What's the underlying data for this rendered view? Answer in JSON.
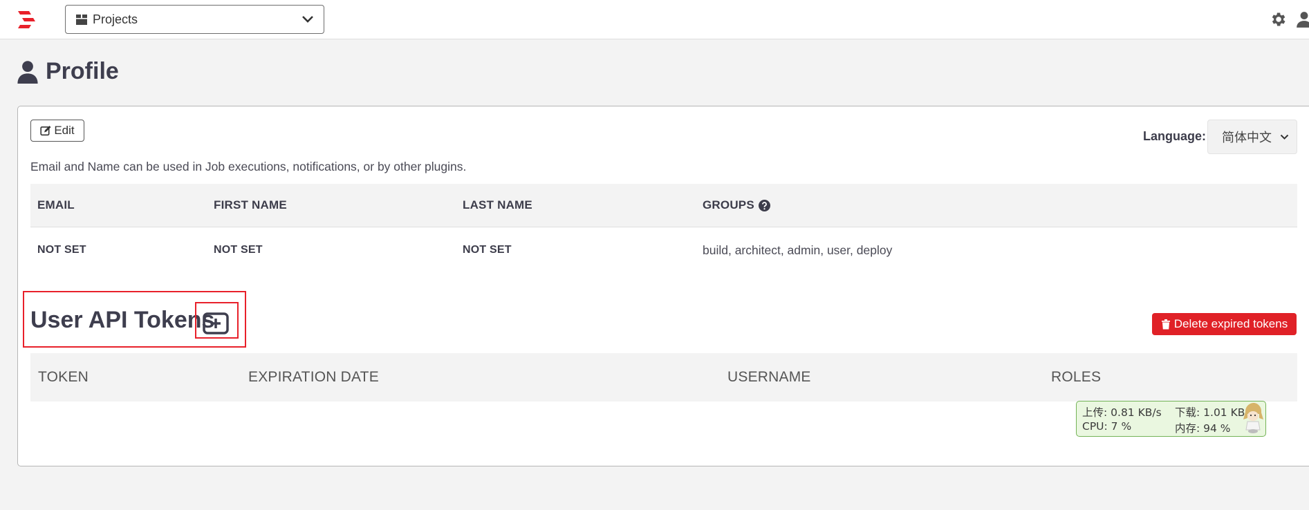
{
  "navbar": {
    "project_selector": {
      "icon": "box-icon",
      "value": "Projects"
    },
    "settings_icon": "gear-icon",
    "user_icon": "user-icon",
    "brand_color": "#e8202a"
  },
  "page": {
    "title": "Profile",
    "title_icon": "user-icon"
  },
  "profile": {
    "edit_label": "Edit",
    "language_label": "Language:",
    "language_value": "简体中文",
    "info_text": "Email and Name can be used in Job executions, notifications, or by other plugins.",
    "table": {
      "headers": [
        "EMAIL",
        "FIRST NAME",
        "LAST NAME",
        "GROUPS"
      ],
      "row": [
        "NOT SET",
        "NOT SET",
        "NOT SET",
        "build, architect, admin, user, deploy"
      ]
    }
  },
  "tokens": {
    "title": "User API Tokens",
    "add_icon": "plus-square-icon",
    "delete_label": "Delete expired tokens",
    "delete_color": "#e02127",
    "table": {
      "headers": [
        "TOKEN",
        "EXPIRATION DATE",
        "USERNAME",
        "ROLES"
      ]
    }
  },
  "annotation": {
    "highlight_color": "#e8202a"
  },
  "net_monitor": {
    "upload": "上传: 0.81 KB/s",
    "download": "下载: 1.01 KB/s",
    "cpu": "CPU: 7 %",
    "memory": "内存: 94 %",
    "bg_color": "#eaf7e0",
    "border_color": "#73b356"
  }
}
